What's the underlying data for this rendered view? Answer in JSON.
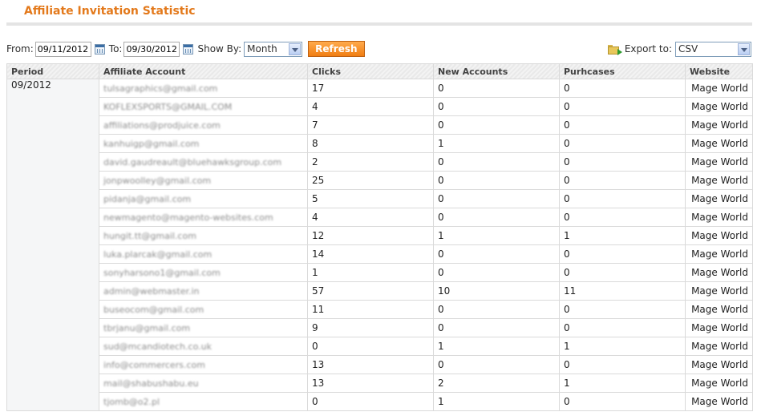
{
  "header": {
    "title": "Affiliate Invitation Statistic"
  },
  "filters": {
    "from_label": "From:",
    "from_value": "09/11/2012",
    "to_label": "To:",
    "to_value": "09/30/2012",
    "show_by_label": "Show By:",
    "show_by_value": "Month",
    "refresh_label": "Refresh"
  },
  "export": {
    "label": "Export to:",
    "value": "CSV"
  },
  "table": {
    "columns": [
      "Period",
      "Affiliate Account",
      "Clicks",
      "New Accounts",
      "Purhcases",
      "Website"
    ],
    "period": "09/2012",
    "rows": [
      {
        "account": "tulsagraphics@gmail.com",
        "clicks": "17",
        "new_accounts": "0",
        "purchases": "0",
        "website": "Mage World"
      },
      {
        "account": "KOFLEXSPORTS@GMAIL.COM",
        "clicks": "4",
        "new_accounts": "0",
        "purchases": "0",
        "website": "Mage World"
      },
      {
        "account": "affiliations@prodjuice.com",
        "clicks": "7",
        "new_accounts": "0",
        "purchases": "0",
        "website": "Mage World"
      },
      {
        "account": "kanhuigp@gmail.com",
        "clicks": "8",
        "new_accounts": "1",
        "purchases": "0",
        "website": "Mage World"
      },
      {
        "account": "david.gaudreault@bluehawksgroup.com",
        "clicks": "2",
        "new_accounts": "0",
        "purchases": "0",
        "website": "Mage World"
      },
      {
        "account": "jonpwoolley@gmail.com",
        "clicks": "25",
        "new_accounts": "0",
        "purchases": "0",
        "website": "Mage World"
      },
      {
        "account": "pidanja@gmail.com",
        "clicks": "5",
        "new_accounts": "0",
        "purchases": "0",
        "website": "Mage World"
      },
      {
        "account": "newmagento@magento-websites.com",
        "clicks": "4",
        "new_accounts": "0",
        "purchases": "0",
        "website": "Mage World"
      },
      {
        "account": "hungit.tt@gmail.com",
        "clicks": "12",
        "new_accounts": "1",
        "purchases": "1",
        "website": "Mage World"
      },
      {
        "account": "luka.plarcak@gmail.com",
        "clicks": "14",
        "new_accounts": "0",
        "purchases": "0",
        "website": "Mage World"
      },
      {
        "account": "sonyharsono1@gmail.com",
        "clicks": "1",
        "new_accounts": "0",
        "purchases": "0",
        "website": "Mage World"
      },
      {
        "account": "admin@webmaster.in",
        "clicks": "57",
        "new_accounts": "10",
        "purchases": "11",
        "website": "Mage World"
      },
      {
        "account": "buseocom@gmail.com",
        "clicks": "11",
        "new_accounts": "0",
        "purchases": "0",
        "website": "Mage World"
      },
      {
        "account": "tbrjanu@gmail.com",
        "clicks": "9",
        "new_accounts": "0",
        "purchases": "0",
        "website": "Mage World"
      },
      {
        "account": "sud@mcandiotech.co.uk",
        "clicks": "0",
        "new_accounts": "1",
        "purchases": "1",
        "website": "Mage World"
      },
      {
        "account": "info@commercers.com",
        "clicks": "13",
        "new_accounts": "0",
        "purchases": "0",
        "website": "Mage World"
      },
      {
        "account": "mail@shabushabu.eu",
        "clicks": "13",
        "new_accounts": "2",
        "purchases": "1",
        "website": "Mage World"
      },
      {
        "account": "tjomb@o2.pl",
        "clicks": "0",
        "new_accounts": "1",
        "purchases": "0",
        "website": "Mage World"
      }
    ]
  }
}
